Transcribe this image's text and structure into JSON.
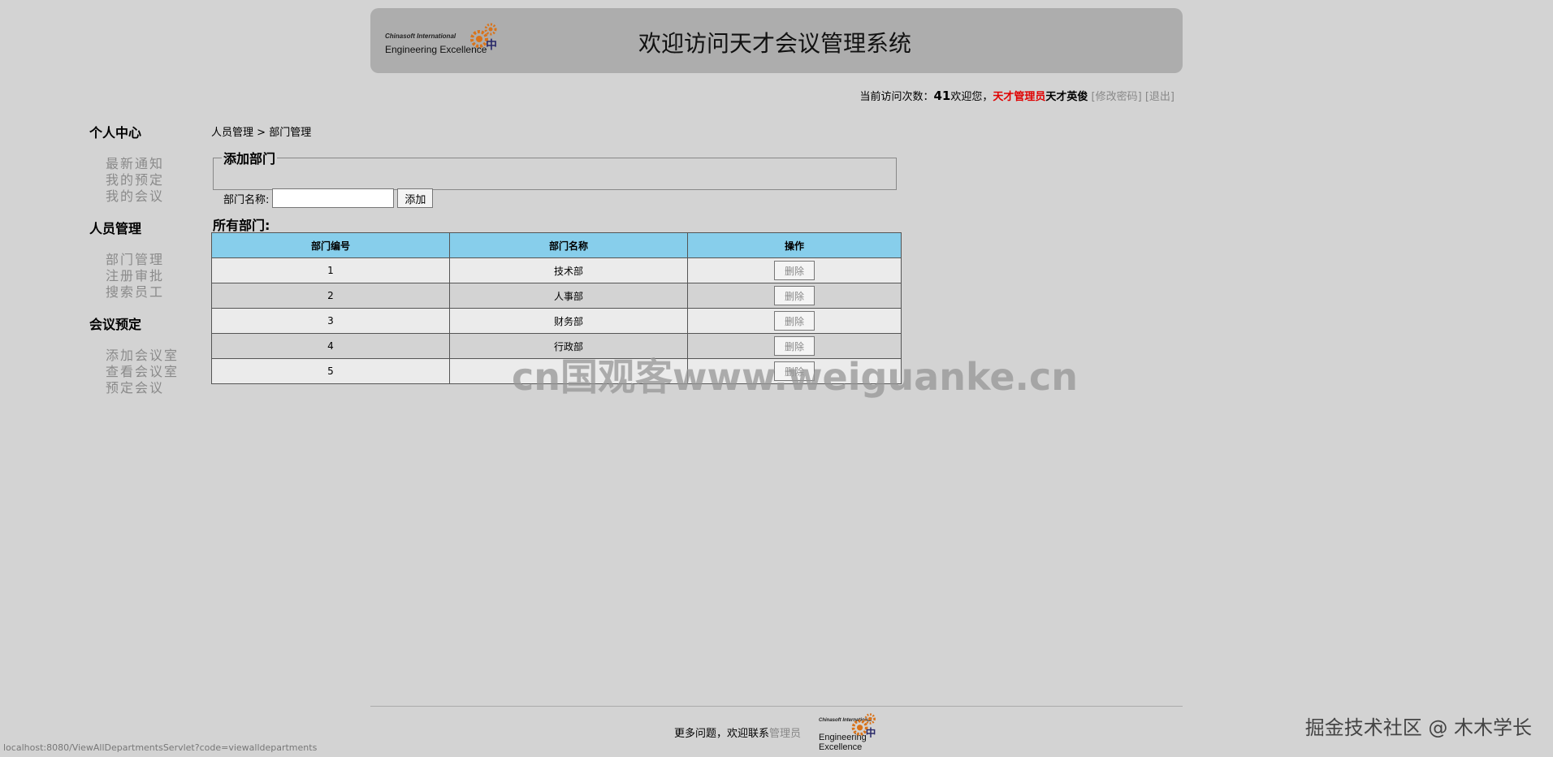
{
  "header": {
    "logo_small": "Chinasoft International",
    "logo_big": "Engineering Excellence",
    "title": "欢迎访问天才会议管理系统"
  },
  "userbar": {
    "visits_label": "当前访问次数：",
    "visits_count": "41",
    "welcome": "欢迎您，",
    "role": "天才管理员",
    "username": "天才英俊",
    "change_password": "[修改密码]",
    "logout": "[退出]"
  },
  "sidebar": {
    "groups": [
      {
        "title": "个人中心",
        "items": [
          "最新通知",
          "我的预定",
          "我的会议"
        ]
      },
      {
        "title": "人员管理",
        "items": [
          "部门管理",
          "注册审批",
          "搜索员工"
        ]
      },
      {
        "title": "会议预定",
        "items": [
          "添加会议室",
          "查看会议室",
          "预定会议"
        ]
      }
    ]
  },
  "breadcrumb": {
    "parent": "人员管理",
    "sep": ">",
    "current": "部门管理"
  },
  "add_form": {
    "legend": "添加部门",
    "label": "部门名称:",
    "input_value": "",
    "button": "添加"
  },
  "all_title": "所有部门:",
  "table": {
    "headers": [
      "部门编号",
      "部门名称",
      "操作"
    ],
    "rows": [
      {
        "id": "1",
        "name": "技术部",
        "action": "删除"
      },
      {
        "id": "2",
        "name": "人事部",
        "action": "删除"
      },
      {
        "id": "3",
        "name": "财务部",
        "action": "删除"
      },
      {
        "id": "4",
        "name": "行政部",
        "action": "删除"
      },
      {
        "id": "5",
        "name": "",
        "action": "删除"
      }
    ]
  },
  "watermark": "cn国观客www.weiguanke.cn",
  "footer": {
    "text": "更多问题，欢迎联系",
    "link": "管理员",
    "logo_small": "Chinasoft International",
    "logo_big_1": "Engineering",
    "logo_big_2": "Excellence"
  },
  "status_url": "localhost:8080/ViewAllDepartmentsServlet?code=viewalldepartments",
  "credit": "掘金技术社区 @ 木木学长",
  "colors": {
    "accent_red": "#e00000",
    "table_header": "#87ceeb",
    "background": "#d3d3d3"
  }
}
